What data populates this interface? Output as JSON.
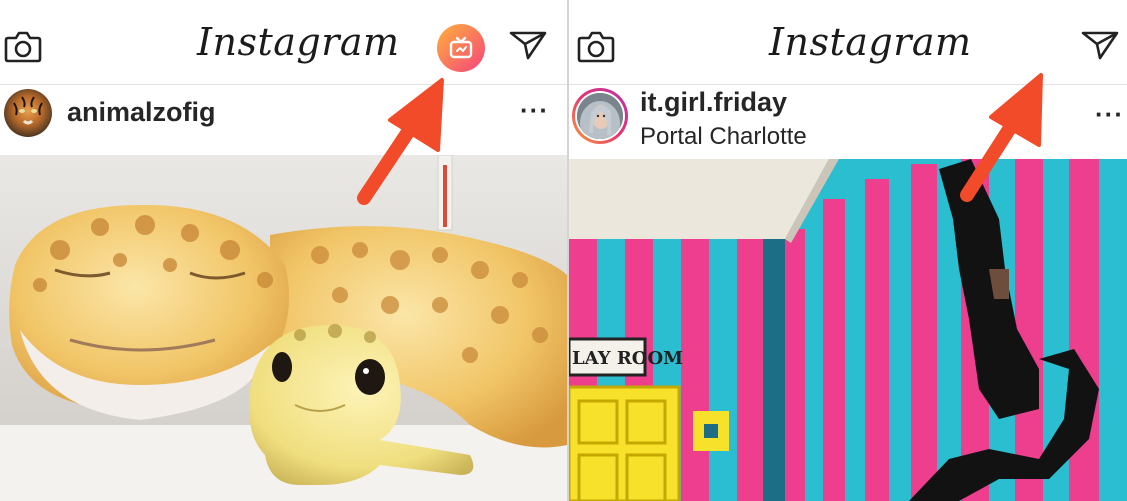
{
  "left_screen": {
    "app_name": "Instagram",
    "icons": {
      "camera": "camera-icon",
      "igtv": "igtv-icon",
      "direct": "direct-message-icon",
      "more": "more-options-icon"
    },
    "post": {
      "username": "animalzofig",
      "more_label": "···"
    },
    "annotation_arrow_color": "#f24b2a",
    "igtv_gradient": [
      "#ffb13b",
      "#f5447c"
    ]
  },
  "right_screen": {
    "app_name": "Instagram",
    "icons": {
      "camera": "camera-icon",
      "direct": "direct-message-icon",
      "more": "more-options-icon"
    },
    "post": {
      "username": "it.girl.friday",
      "location": "Portal Charlotte",
      "more_label": "···",
      "photo_sign_text": "LAY ROOM"
    },
    "annotation_arrow_color": "#f24b2a",
    "stripe_colors": [
      "#ee3f8e",
      "#2bbdd0"
    ]
  }
}
